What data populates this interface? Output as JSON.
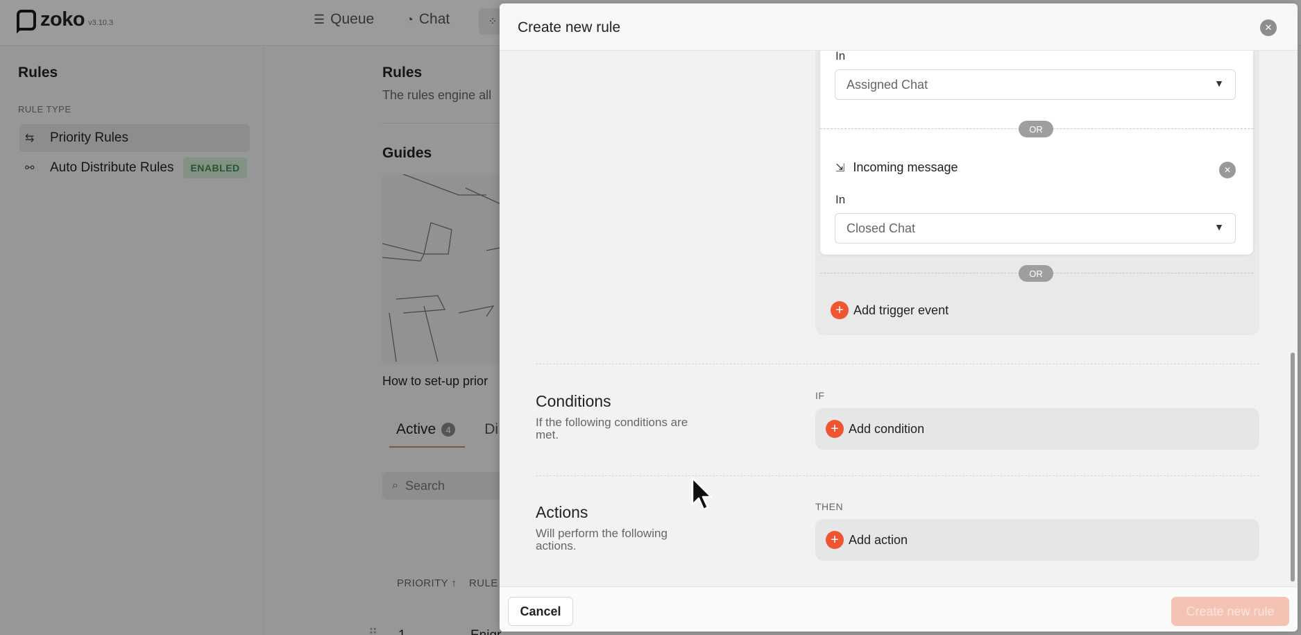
{
  "app": {
    "logo_text": "zoko",
    "version": "v3.10.3",
    "nav": {
      "queue": "Queue",
      "chat": "Chat"
    }
  },
  "sidebar": {
    "title": "Rules",
    "section_label": "RULE TYPE",
    "items": [
      {
        "label": "Priority Rules",
        "icon": "sliders-icon",
        "active": true
      },
      {
        "label": "Auto Distribute Rules",
        "icon": "share-nodes-icon",
        "badge": "ENABLED"
      }
    ]
  },
  "main": {
    "title": "Rules",
    "description": "The rules engine all",
    "guides_title": "Guides",
    "guide_caption": "How to set-up prior",
    "tabs": [
      {
        "label": "Active",
        "count": "4"
      },
      {
        "label": "Di"
      }
    ],
    "search_placeholder": "Search",
    "table": {
      "headers": [
        "PRIORITY ↑",
        "RULE"
      ],
      "rows": [
        {
          "priority": "1",
          "rule": "Enigr"
        }
      ]
    }
  },
  "modal": {
    "title": "Create new rule",
    "trigger": {
      "in_label": "In",
      "first_select_value": "Assigned Chat",
      "or_label": "OR",
      "event": {
        "name": "Incoming message",
        "in_label": "In",
        "select_value": "Closed Chat"
      },
      "add_trigger_label": "Add trigger event"
    },
    "conditions": {
      "title": "Conditions",
      "description": "If the following conditions are met.",
      "tag": "IF",
      "add_label": "Add condition"
    },
    "actions": {
      "title": "Actions",
      "description": "Will perform the following actions.",
      "tag": "THEN",
      "add_label": "Add action"
    },
    "footer": {
      "cancel_label": "Cancel",
      "create_label": "Create new rule"
    }
  },
  "colors": {
    "accent": "#ee5530",
    "badge_bg": "#d3e9d6",
    "badge_text": "#3e8a4c",
    "create_disabled": "#f4c3b4"
  }
}
